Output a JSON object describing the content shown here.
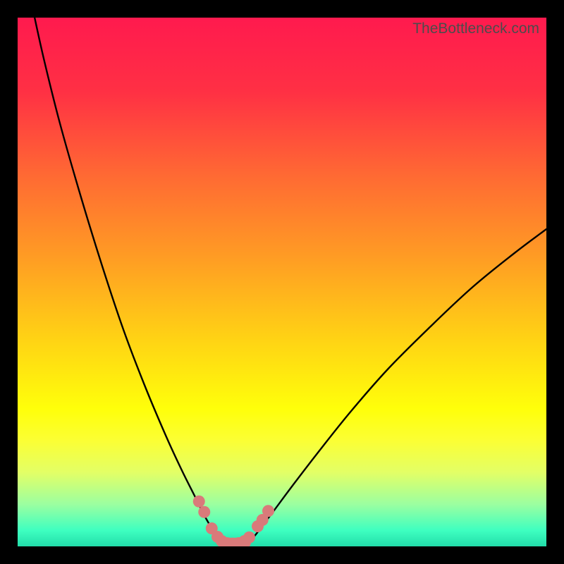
{
  "watermark": "TheBottleneck.com",
  "chart_data": {
    "type": "line",
    "title": "",
    "xlabel": "",
    "ylabel": "",
    "xlim": [
      0,
      100
    ],
    "ylim": [
      0,
      100
    ],
    "background_gradient": [
      {
        "stop": 0.0,
        "color": "#ff1a4e"
      },
      {
        "stop": 0.14,
        "color": "#ff3044"
      },
      {
        "stop": 0.3,
        "color": "#ff6a33"
      },
      {
        "stop": 0.45,
        "color": "#ff9b24"
      },
      {
        "stop": 0.6,
        "color": "#ffd015"
      },
      {
        "stop": 0.74,
        "color": "#ffff0a"
      },
      {
        "stop": 0.8,
        "color": "#fbff34"
      },
      {
        "stop": 0.86,
        "color": "#e3ff66"
      },
      {
        "stop": 0.92,
        "color": "#9cffa0"
      },
      {
        "stop": 0.97,
        "color": "#3effc0"
      },
      {
        "stop": 1.0,
        "color": "#22ddaa"
      }
    ],
    "series": [
      {
        "name": "left-curve",
        "type": "line",
        "color": "#000000",
        "points": [
          {
            "x": 3.0,
            "y": 101.0
          },
          {
            "x": 5.0,
            "y": 92.0
          },
          {
            "x": 8.0,
            "y": 80.0
          },
          {
            "x": 12.0,
            "y": 66.0
          },
          {
            "x": 16.0,
            "y": 53.0
          },
          {
            "x": 20.0,
            "y": 41.0
          },
          {
            "x": 24.0,
            "y": 30.5
          },
          {
            "x": 28.0,
            "y": 21.0
          },
          {
            "x": 31.0,
            "y": 14.5
          },
          {
            "x": 33.5,
            "y": 9.5
          },
          {
            "x": 35.5,
            "y": 5.5
          },
          {
            "x": 37.0,
            "y": 3.0
          },
          {
            "x": 38.2,
            "y": 1.4
          },
          {
            "x": 39.0,
            "y": 0.8
          }
        ]
      },
      {
        "name": "right-curve",
        "type": "line",
        "color": "#000000",
        "points": [
          {
            "x": 43.5,
            "y": 0.8
          },
          {
            "x": 44.5,
            "y": 1.6
          },
          {
            "x": 46.0,
            "y": 3.5
          },
          {
            "x": 48.5,
            "y": 6.8
          },
          {
            "x": 52.0,
            "y": 11.5
          },
          {
            "x": 57.0,
            "y": 18.0
          },
          {
            "x": 63.0,
            "y": 25.5
          },
          {
            "x": 70.0,
            "y": 33.5
          },
          {
            "x": 78.0,
            "y": 41.5
          },
          {
            "x": 86.0,
            "y": 49.0
          },
          {
            "x": 94.0,
            "y": 55.5
          },
          {
            "x": 100.0,
            "y": 60.0
          }
        ]
      },
      {
        "name": "bottom-markers",
        "type": "scatter",
        "color": "#d97a7a",
        "points": [
          {
            "x": 34.3,
            "y": 8.5
          },
          {
            "x": 35.3,
            "y": 6.5
          },
          {
            "x": 36.7,
            "y": 3.4
          },
          {
            "x": 37.8,
            "y": 1.8
          },
          {
            "x": 38.6,
            "y": 1.0
          },
          {
            "x": 39.6,
            "y": 0.6
          },
          {
            "x": 40.7,
            "y": 0.5
          },
          {
            "x": 41.8,
            "y": 0.6
          },
          {
            "x": 42.9,
            "y": 1.0
          },
          {
            "x": 43.8,
            "y": 1.7
          },
          {
            "x": 45.4,
            "y": 3.8
          },
          {
            "x": 46.3,
            "y": 5.0
          },
          {
            "x": 47.4,
            "y": 6.7
          }
        ]
      },
      {
        "name": "bottom-flat",
        "type": "line",
        "color": "#d97a7a",
        "points": [
          {
            "x": 39.0,
            "y": 0.7
          },
          {
            "x": 43.2,
            "y": 0.7
          }
        ]
      }
    ]
  }
}
